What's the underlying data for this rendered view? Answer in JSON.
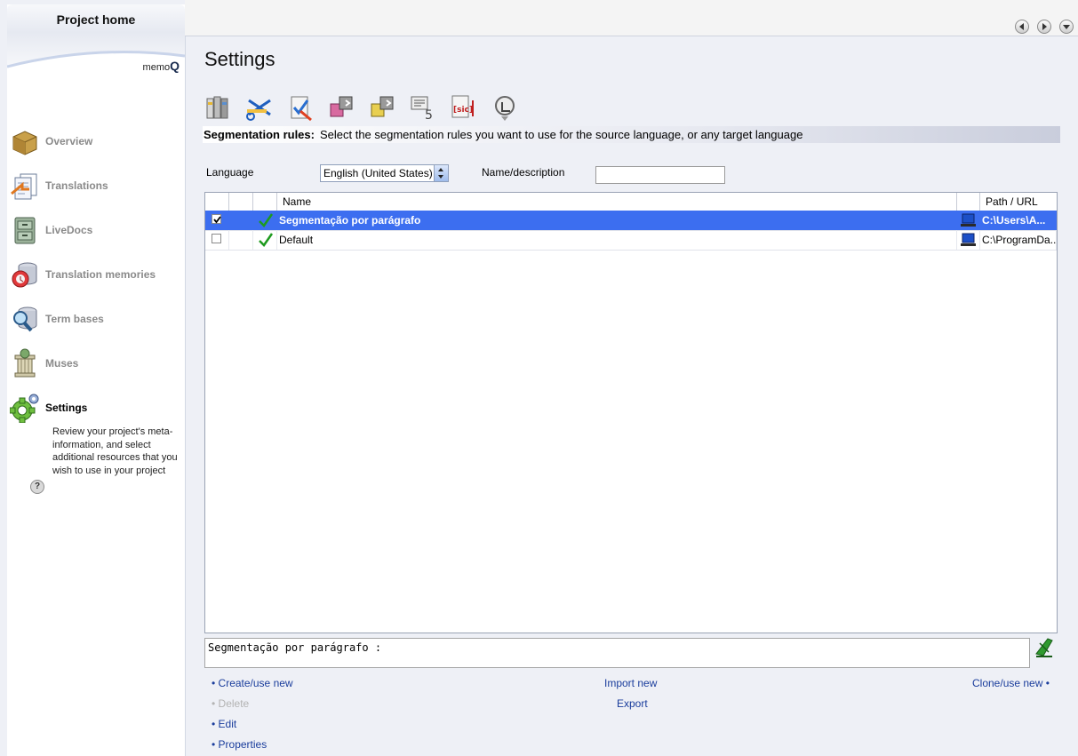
{
  "sidebar": {
    "title": "Project home",
    "brand_prefix": "memo",
    "brand_suffix": "Q",
    "items": [
      {
        "label": "Overview"
      },
      {
        "label": "Translations"
      },
      {
        "label": "LiveDocs"
      },
      {
        "label": "Translation memories"
      },
      {
        "label": "Term bases"
      },
      {
        "label": "Muses"
      },
      {
        "label": "Settings"
      }
    ],
    "active_description": "Review your project's meta-information, and select additional resources that you wish to use in your project",
    "help": "?"
  },
  "main": {
    "title": "Settings",
    "section": {
      "label": "Segmentation rules:",
      "description": "Select the segmentation rules you want to use for the source language, or any target language"
    },
    "filters": {
      "language_label": "Language",
      "language_value": "English (United States)",
      "name_label": "Name/description",
      "name_value": ""
    },
    "table": {
      "columns": [
        "Name",
        "Path / URL"
      ],
      "rows": [
        {
          "name": "Segmentação por parágrafo",
          "path": "C:\\Users\\A...",
          "checked": true
        },
        {
          "name": "Default",
          "path": "C:\\ProgramDa...",
          "checked": false
        }
      ]
    },
    "description_text": "Segmentação por parágrafo :",
    "actions": {
      "create": "• Create/use new",
      "delete": "• Delete",
      "edit": "• Edit",
      "properties": "• Properties",
      "import": "Import new",
      "export": "Export",
      "clone": "Clone/use new •"
    }
  },
  "colors": {
    "selection": "#3c6ef0",
    "link": "#1a3d9c",
    "check_green": "#1e9a1e"
  }
}
